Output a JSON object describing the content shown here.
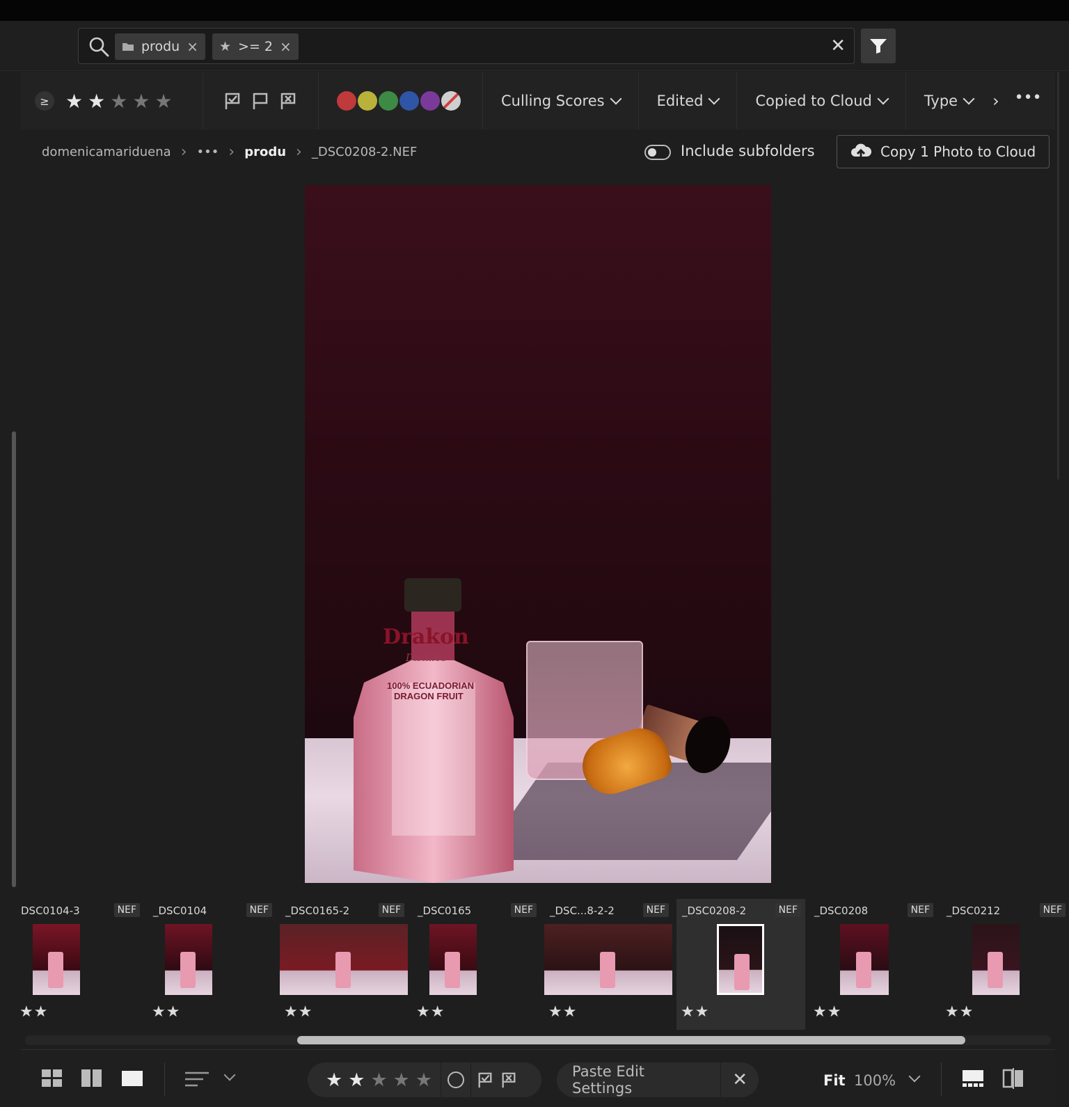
{
  "search": {
    "chips": [
      {
        "icon": "folder-icon",
        "label": "produ"
      },
      {
        "icon": "star-icon",
        "label": ">= 2"
      }
    ]
  },
  "filters": {
    "ge_label": "≥",
    "rating": 2,
    "rating_max": 5,
    "color_labels": [
      "#c0393b",
      "#b8b23a",
      "#3d8a45",
      "#2f55a6",
      "#7a3a9a",
      "none"
    ],
    "dropdowns": [
      "Culling Scores",
      "Edited",
      "Copied to Cloud",
      "Type"
    ]
  },
  "breadcrumb": {
    "root": "domenicamariduena",
    "ellipsis": "•••",
    "folder": "produ",
    "file": "_DSC0208-2.NEF"
  },
  "subfolders_label": "Include subfolders",
  "copy_button": "Copy 1 Photo to Cloud",
  "photo": {
    "brand": "Drakon",
    "sub": "Distilled",
    "line1": "100% ECUADORIAN",
    "line2": "DRAGON FRUIT"
  },
  "filmstrip": [
    {
      "name": "DSC0104-3",
      "badge": "NEF",
      "stars": "★★"
    },
    {
      "name": "_DSC0104",
      "badge": "NEF",
      "stars": "★★"
    },
    {
      "name": "_DSC0165-2",
      "badge": "NEF",
      "stars": "★★"
    },
    {
      "name": "_DSC0165",
      "badge": "NEF",
      "stars": "★★"
    },
    {
      "name": "_DSC...8-2-2",
      "badge": "NEF",
      "stars": "★★"
    },
    {
      "name": "_DSC0208-2",
      "badge": "NEF",
      "stars": "★★"
    },
    {
      "name": "_DSC0208",
      "badge": "NEF",
      "stars": "★★"
    },
    {
      "name": "_DSC0212",
      "badge": "NEF",
      "stars": "★★"
    }
  ],
  "bottom": {
    "paste_label": "Paste Edit Settings",
    "fit_label": "Fit",
    "zoom_label": "100%"
  }
}
